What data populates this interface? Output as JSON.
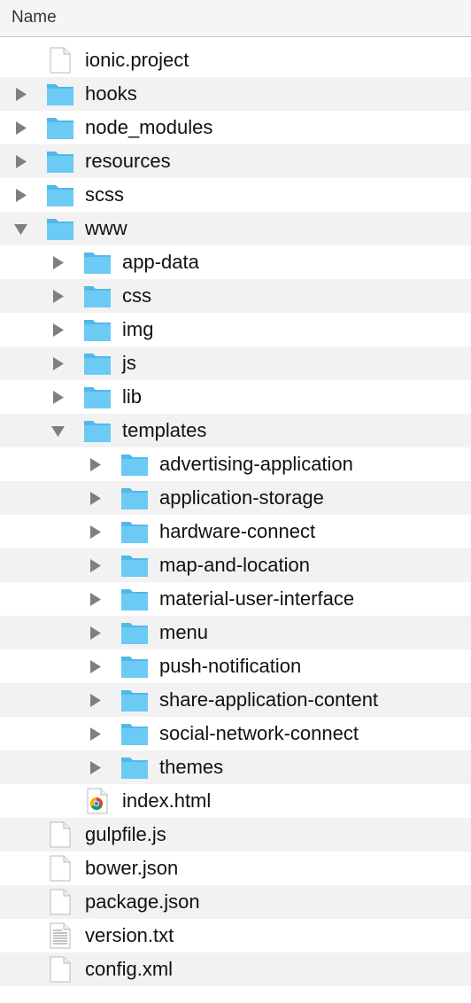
{
  "header": {
    "name_column": "Name"
  },
  "items": [
    {
      "name": "ionic.project",
      "type": "file",
      "depth": 0
    },
    {
      "name": "hooks",
      "type": "folder",
      "depth": 0,
      "expanded": false
    },
    {
      "name": "node_modules",
      "type": "folder",
      "depth": 0,
      "expanded": false
    },
    {
      "name": "resources",
      "type": "folder",
      "depth": 0,
      "expanded": false
    },
    {
      "name": "scss",
      "type": "folder",
      "depth": 0,
      "expanded": false
    },
    {
      "name": "www",
      "type": "folder",
      "depth": 0,
      "expanded": true
    },
    {
      "name": "app-data",
      "type": "folder",
      "depth": 1,
      "expanded": false
    },
    {
      "name": "css",
      "type": "folder",
      "depth": 1,
      "expanded": false
    },
    {
      "name": "img",
      "type": "folder",
      "depth": 1,
      "expanded": false
    },
    {
      "name": "js",
      "type": "folder",
      "depth": 1,
      "expanded": false
    },
    {
      "name": "lib",
      "type": "folder",
      "depth": 1,
      "expanded": false
    },
    {
      "name": "templates",
      "type": "folder",
      "depth": 1,
      "expanded": true
    },
    {
      "name": "advertising-application",
      "type": "folder",
      "depth": 2,
      "expanded": false
    },
    {
      "name": "application-storage",
      "type": "folder",
      "depth": 2,
      "expanded": false
    },
    {
      "name": "hardware-connect",
      "type": "folder",
      "depth": 2,
      "expanded": false
    },
    {
      "name": "map-and-location",
      "type": "folder",
      "depth": 2,
      "expanded": false
    },
    {
      "name": "material-user-interface",
      "type": "folder",
      "depth": 2,
      "expanded": false
    },
    {
      "name": "menu",
      "type": "folder",
      "depth": 2,
      "expanded": false
    },
    {
      "name": "push-notification",
      "type": "folder",
      "depth": 2,
      "expanded": false
    },
    {
      "name": "share-application-content",
      "type": "folder",
      "depth": 2,
      "expanded": false
    },
    {
      "name": "social-network-connect",
      "type": "folder",
      "depth": 2,
      "expanded": false
    },
    {
      "name": "themes",
      "type": "folder",
      "depth": 2,
      "expanded": false
    },
    {
      "name": "index.html",
      "type": "html-file",
      "depth": 1
    },
    {
      "name": "gulpfile.js",
      "type": "file",
      "depth": 0
    },
    {
      "name": "bower.json",
      "type": "file",
      "depth": 0
    },
    {
      "name": "package.json",
      "type": "file",
      "depth": 0
    },
    {
      "name": "version.txt",
      "type": "text-file",
      "depth": 0
    },
    {
      "name": "config.xml",
      "type": "file",
      "depth": 0
    }
  ],
  "colors": {
    "folder_front": "#6ccbf5",
    "folder_back": "#52b8e8",
    "disclosure": "#7f7f7f",
    "alt_row": "#f2f2f2"
  }
}
